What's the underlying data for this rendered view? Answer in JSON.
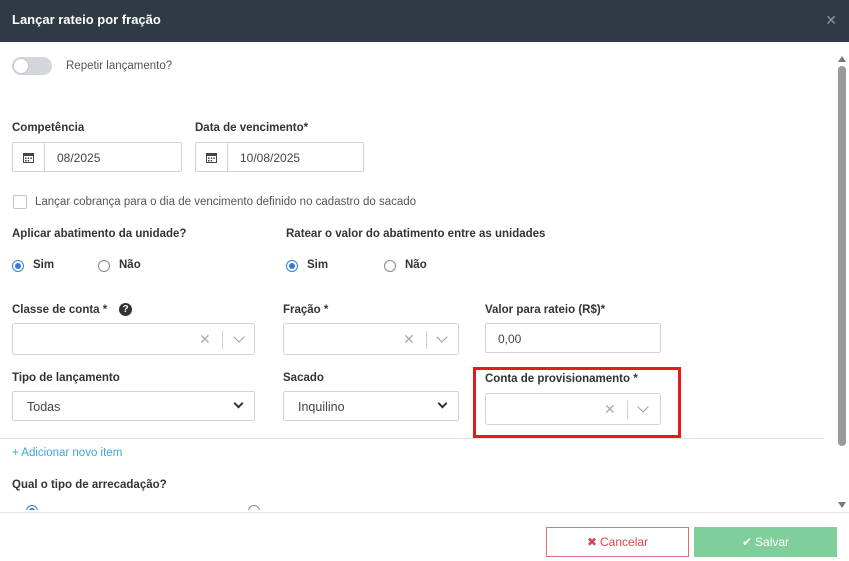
{
  "header": {
    "title": "Lançar rateio por fração",
    "close_icon": "close-icon"
  },
  "repeat": {
    "label": "Repetir lançamento?"
  },
  "competencia": {
    "label": "Competência",
    "value": "08/2025"
  },
  "vencimento": {
    "label": "Data de vencimento*",
    "value": "10/08/2025"
  },
  "cobranca": {
    "label": "Lançar cobrança para o dia de vencimento definido no cadastro do sacado"
  },
  "abatimento": {
    "label": "Aplicar abatimento da unidade?",
    "opt_yes": "Sim",
    "opt_no": "Não",
    "selected": "Sim"
  },
  "ratear": {
    "label": "Ratear o valor do abatimento entre as unidades",
    "opt_yes": "Sim",
    "opt_no": "Não",
    "selected": "Sim"
  },
  "classe": {
    "label": "Classe de conta *",
    "help_icon": "question-circle-icon"
  },
  "fracao": {
    "label": "Fração *"
  },
  "valor": {
    "label": "Valor para rateio (R$)*",
    "value": "0,00"
  },
  "tipo": {
    "label": "Tipo de lançamento",
    "value": "Todas"
  },
  "sacado": {
    "label": "Sacado",
    "value": "Inquilino"
  },
  "provisionamento": {
    "label": "Conta de provisionamento *"
  },
  "add_item": {
    "label": "+ Adicionar novo item"
  },
  "arrecadacao": {
    "label": "Qual o tipo de arrecadação?"
  },
  "footer": {
    "cancel_label": "Cancelar",
    "save_label": "Salvar"
  },
  "colors": {
    "header_bg": "#2f3a45",
    "accent": "#2f7fd6",
    "save_bg": "#7fcf9a",
    "cancel": "#d9454f",
    "highlight": "#e31b1b",
    "link": "#39a8d6"
  }
}
